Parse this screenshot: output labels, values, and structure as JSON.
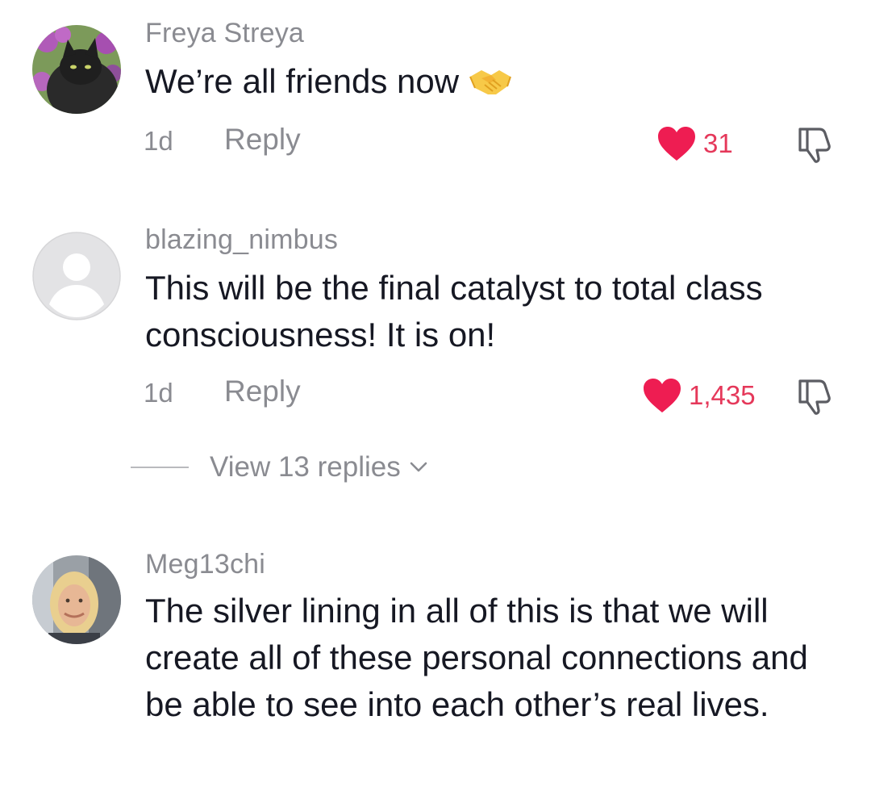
{
  "comments": [
    {
      "username": "Freya Streya",
      "text": "We’re all friends now",
      "emoji": "handshake",
      "time": "1d",
      "reply_label": "Reply",
      "likes": "31",
      "liked": true
    },
    {
      "username": "blazing_nimbus",
      "text": "This will be the final catalyst to total class consciousness! It is on!",
      "time": "1d",
      "reply_label": "Reply",
      "likes": "1,435",
      "liked": true,
      "view_replies": "View 13 replies"
    },
    {
      "username": "Meg13chi",
      "text": "The silver lining in all of this is that we will create all of these personal connections and be able to see into each other’s real lives."
    }
  ],
  "colors": {
    "like_red": "#ee1d52",
    "like_count": "#e5385a",
    "muted": "#8a8b91",
    "text": "#161823"
  },
  "icons": [
    "heart-icon",
    "thumbs-down-icon",
    "chevron-down-icon",
    "handshake-emoji"
  ]
}
